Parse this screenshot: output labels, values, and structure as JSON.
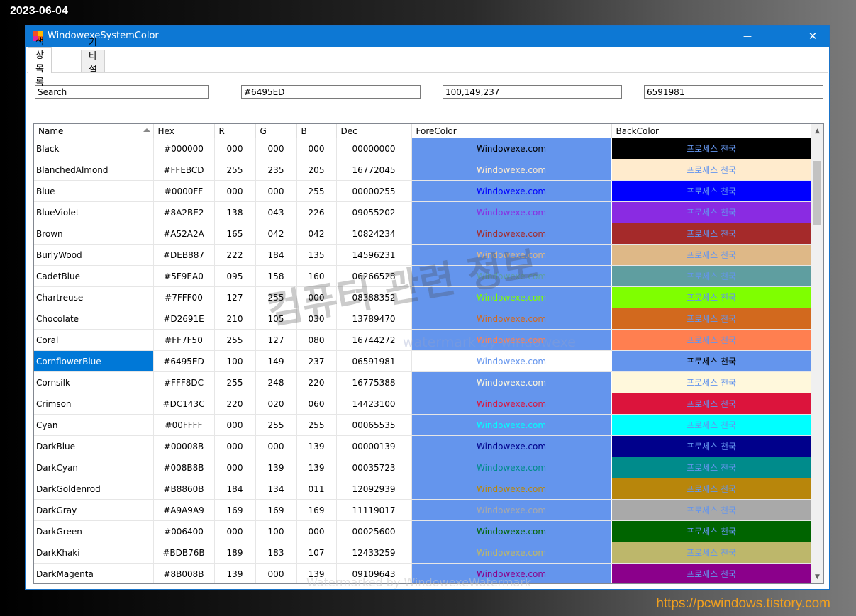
{
  "desktop": {
    "date": "2023-06-04",
    "site_url": "https://pcwindows.tistory.com"
  },
  "window": {
    "title": "WindowexeSystemColor",
    "minimize": "—",
    "close": "✕"
  },
  "tabs": [
    {
      "label": "색상 목록",
      "active": true
    },
    {
      "label": "기타 설정",
      "active": false
    }
  ],
  "fields": {
    "search": "Search",
    "hex": "#6495ED",
    "rgb": "100,149,237",
    "dec": "6591981"
  },
  "grid": {
    "columns": [
      "Name",
      "Hex",
      "R",
      "G",
      "B",
      "Dec",
      "ForeColor",
      "BackColor"
    ],
    "fore_text": "Windowexe.com",
    "back_text": "프로세스 천국",
    "fore_bg": "#6495ED",
    "selected_index": 10,
    "rows": [
      {
        "name": "Black",
        "hex": "#000000",
        "r": "000",
        "g": "000",
        "b": "000",
        "dec": "00000000",
        "color": "#000000"
      },
      {
        "name": "BlanchedAlmond",
        "hex": "#FFEBCD",
        "r": "255",
        "g": "235",
        "b": "205",
        "dec": "16772045",
        "color": "#FFEBCD"
      },
      {
        "name": "Blue",
        "hex": "#0000FF",
        "r": "000",
        "g": "000",
        "b": "255",
        "dec": "00000255",
        "color": "#0000FF"
      },
      {
        "name": "BlueViolet",
        "hex": "#8A2BE2",
        "r": "138",
        "g": "043",
        "b": "226",
        "dec": "09055202",
        "color": "#8A2BE2"
      },
      {
        "name": "Brown",
        "hex": "#A52A2A",
        "r": "165",
        "g": "042",
        "b": "042",
        "dec": "10824234",
        "color": "#A52A2A"
      },
      {
        "name": "BurlyWood",
        "hex": "#DEB887",
        "r": "222",
        "g": "184",
        "b": "135",
        "dec": "14596231",
        "color": "#DEB887"
      },
      {
        "name": "CadetBlue",
        "hex": "#5F9EA0",
        "r": "095",
        "g": "158",
        "b": "160",
        "dec": "06266528",
        "color": "#5F9EA0"
      },
      {
        "name": "Chartreuse",
        "hex": "#7FFF00",
        "r": "127",
        "g": "255",
        "b": "000",
        "dec": "08388352",
        "color": "#7FFF00"
      },
      {
        "name": "Chocolate",
        "hex": "#D2691E",
        "r": "210",
        "g": "105",
        "b": "030",
        "dec": "13789470",
        "color": "#D2691E"
      },
      {
        "name": "Coral",
        "hex": "#FF7F50",
        "r": "255",
        "g": "127",
        "b": "080",
        "dec": "16744272",
        "color": "#FF7F50"
      },
      {
        "name": "CornflowerBlue",
        "hex": "#6495ED",
        "r": "100",
        "g": "149",
        "b": "237",
        "dec": "06591981",
        "color": "#6495ED"
      },
      {
        "name": "Cornsilk",
        "hex": "#FFF8DC",
        "r": "255",
        "g": "248",
        "b": "220",
        "dec": "16775388",
        "color": "#FFF8DC"
      },
      {
        "name": "Crimson",
        "hex": "#DC143C",
        "r": "220",
        "g": "020",
        "b": "060",
        "dec": "14423100",
        "color": "#DC143C"
      },
      {
        "name": "Cyan",
        "hex": "#00FFFF",
        "r": "000",
        "g": "255",
        "b": "255",
        "dec": "00065535",
        "color": "#00FFFF"
      },
      {
        "name": "DarkBlue",
        "hex": "#00008B",
        "r": "000",
        "g": "000",
        "b": "139",
        "dec": "00000139",
        "color": "#00008B"
      },
      {
        "name": "DarkCyan",
        "hex": "#008B8B",
        "r": "000",
        "g": "139",
        "b": "139",
        "dec": "00035723",
        "color": "#008B8B"
      },
      {
        "name": "DarkGoldenrod",
        "hex": "#B8860B",
        "r": "184",
        "g": "134",
        "b": "011",
        "dec": "12092939",
        "color": "#B8860B"
      },
      {
        "name": "DarkGray",
        "hex": "#A9A9A9",
        "r": "169",
        "g": "169",
        "b": "169",
        "dec": "11119017",
        "color": "#A9A9A9"
      },
      {
        "name": "DarkGreen",
        "hex": "#006400",
        "r": "000",
        "g": "100",
        "b": "000",
        "dec": "00025600",
        "color": "#006400"
      },
      {
        "name": "DarkKhaki",
        "hex": "#BDB76B",
        "r": "189",
        "g": "183",
        "b": "107",
        "dec": "12433259",
        "color": "#BDB76B"
      },
      {
        "name": "DarkMagenta",
        "hex": "#8B008B",
        "r": "139",
        "g": "000",
        "b": "139",
        "dec": "09109643",
        "color": "#8B008B"
      }
    ]
  },
  "watermarks": {
    "main": "컴퓨터 관련 정보",
    "sub": "watermark by windowexe",
    "bottom": "Watermarked by WindowexeWatermark"
  }
}
